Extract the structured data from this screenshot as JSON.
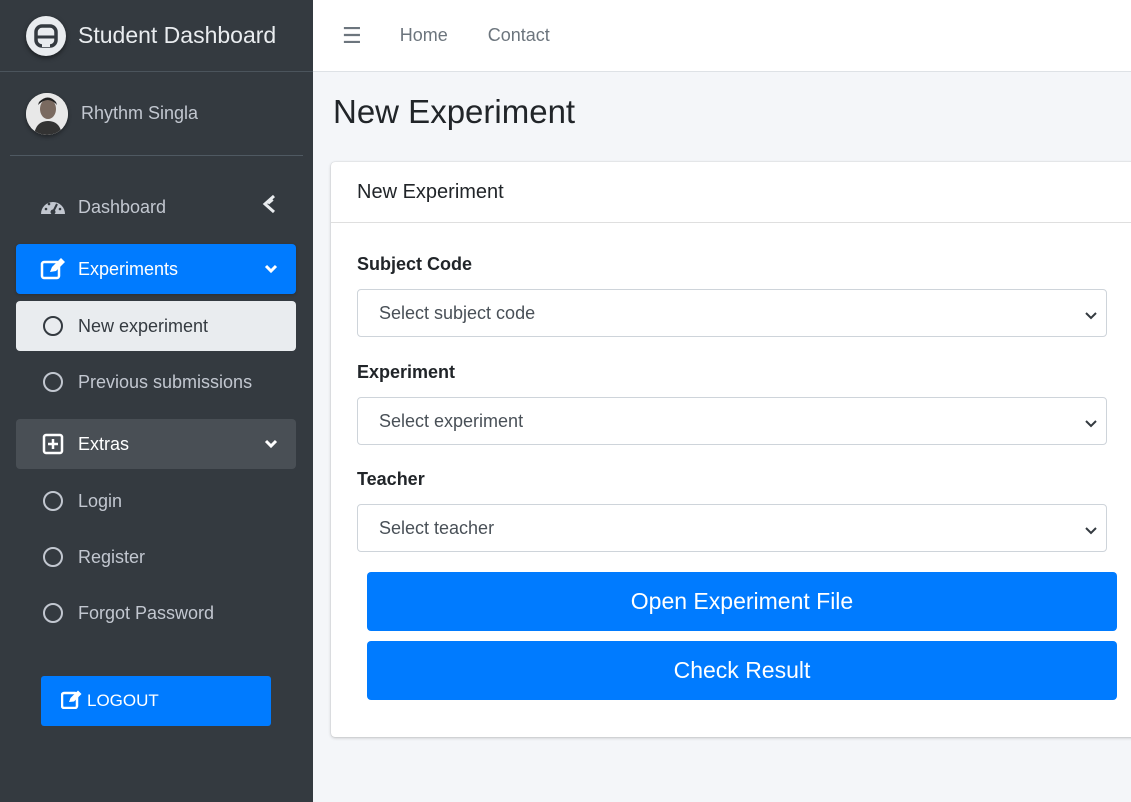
{
  "brand": {
    "title": "Student Dashboard"
  },
  "user": {
    "name": "Rhythm Singla"
  },
  "sidebar": {
    "items": [
      {
        "label": "Dashboard"
      },
      {
        "label": "Experiments"
      },
      {
        "label": "New experiment"
      },
      {
        "label": "Previous submissions"
      },
      {
        "label": "Extras"
      },
      {
        "label": "Login"
      },
      {
        "label": "Register"
      },
      {
        "label": "Forgot Password"
      }
    ],
    "logout_label": "LOGOUT"
  },
  "topbar": {
    "links": [
      "Home",
      "Contact"
    ]
  },
  "page": {
    "title": "New Experiment"
  },
  "card": {
    "header": "New Experiment",
    "fields": [
      {
        "label": "Subject Code",
        "placeholder": "Select subject code"
      },
      {
        "label": "Experiment",
        "placeholder": "Select experiment"
      },
      {
        "label": "Teacher",
        "placeholder": "Select teacher"
      }
    ],
    "buttons": [
      "Open Experiment File",
      "Check Result"
    ]
  },
  "colors": {
    "accent": "#007bff",
    "sidebar": "#343a40",
    "background": "#f4f6f9"
  }
}
